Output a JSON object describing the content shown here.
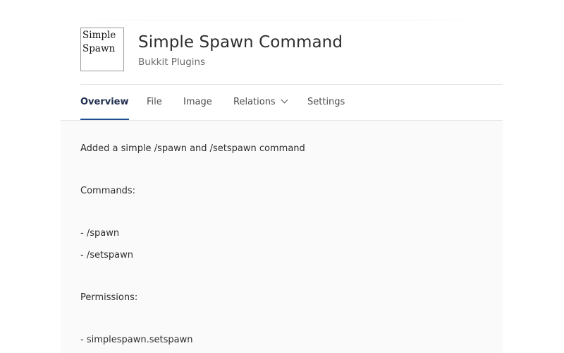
{
  "project": {
    "logo_lines": [
      "Simple",
      "Spawn"
    ],
    "title": "Simple Spawn Command",
    "category": "Bukkit Plugins"
  },
  "tabs": [
    {
      "label": "Overview",
      "active": true
    },
    {
      "label": "File",
      "active": false
    },
    {
      "label": "Image",
      "active": false
    },
    {
      "label": "Relations",
      "active": false,
      "has_dropdown": true
    },
    {
      "label": "Settings",
      "active": false
    }
  ],
  "description": {
    "intro": "Added a simple /spawn and /setspawn command",
    "commands_heading": "Commands:",
    "commands": [
      "- /spawn",
      "- /setspawn"
    ],
    "permissions_heading": "Permissions:",
    "permissions": [
      "- simplespawn.setspawn"
    ]
  },
  "colors": {
    "accent": "#1d4f91",
    "content_background": "#fafafa"
  }
}
